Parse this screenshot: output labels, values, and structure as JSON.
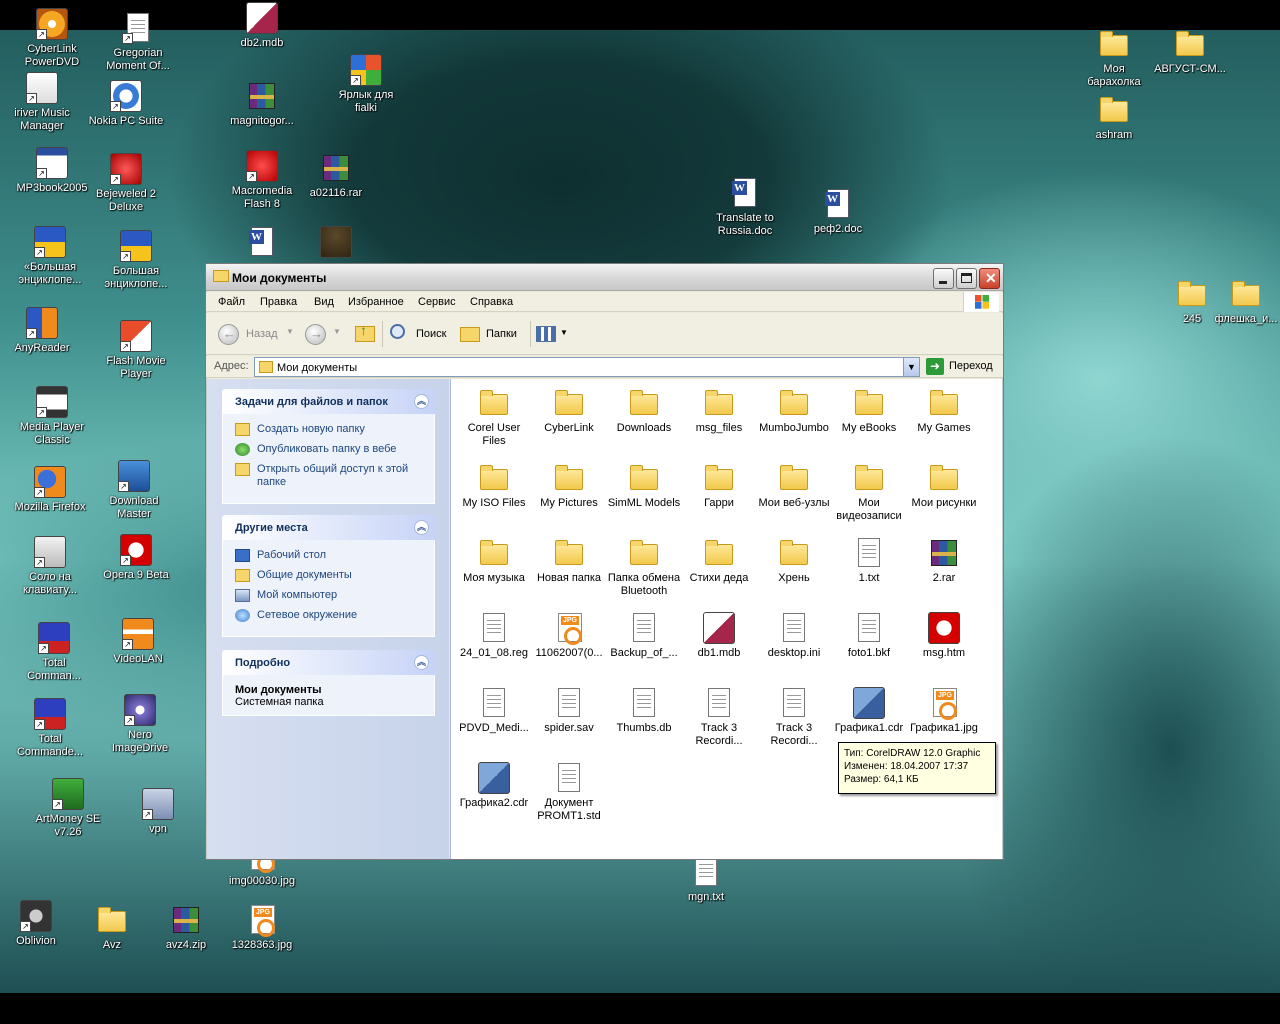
{
  "colors": {
    "wallpaper_dark": "#1e4f53",
    "wallpaper_light": "#8fd6d1",
    "task_link": "#20487e",
    "tooltip_bg": "#ffffe1"
  },
  "desktop_icons": [
    {
      "label": "CyberLink\nPowerDVD",
      "icon": "cyberlink-dvd-icon",
      "shortcut": true
    },
    {
      "label": "Gregorian\nMoment Of...",
      "icon": "text-document-icon",
      "shortcut": true
    },
    {
      "label": "db2.mdb",
      "icon": "access-db-icon",
      "shortcut": false
    },
    {
      "label": "iriver Music\nManager",
      "icon": "iriver-icon",
      "shortcut": true
    },
    {
      "label": "Nokia PC Suite",
      "icon": "nokia-icon",
      "shortcut": true
    },
    {
      "label": "magnitogor...",
      "icon": "rar-archive-icon",
      "shortcut": false
    },
    {
      "label": "Ярлык для\nfialki",
      "icon": "windows-messenger-icon",
      "shortcut": true
    },
    {
      "label": "MP3book2005",
      "icon": "app-window-icon",
      "shortcut": true
    },
    {
      "label": "Bejeweled 2\nDeluxe",
      "icon": "bejeweled-icon",
      "shortcut": true
    },
    {
      "label": "Macromedia\nFlash 8",
      "icon": "flash-icon",
      "shortcut": true
    },
    {
      "label": "a02116.rar",
      "icon": "rar-archive-icon",
      "shortcut": false
    },
    {
      "label": "Translate to\nRussia.doc",
      "icon": "word-document-icon",
      "shortcut": false
    },
    {
      "label": "реф2.doc",
      "icon": "word-document-icon",
      "shortcut": false
    },
    {
      "label": "Моя\nбарахолка",
      "icon": "folder-icon",
      "shortcut": false
    },
    {
      "label": "АВГУСТ-СМ...",
      "icon": "folder-icon",
      "shortcut": false
    },
    {
      "label": "ashram",
      "icon": "folder-icon",
      "shortcut": false
    },
    {
      "label": "«Большая\nэнциклопе...",
      "icon": "encyclopedia-icon",
      "shortcut": true
    },
    {
      "label": "Большая\nэнциклопе...",
      "icon": "encyclopedia-icon",
      "shortcut": true
    },
    {
      "label": "",
      "icon": "word-document-icon",
      "shortcut": false
    },
    {
      "label": "",
      "icon": "tree-icon",
      "shortcut": false
    },
    {
      "label": "245",
      "icon": "folder-icon",
      "shortcut": false
    },
    {
      "label": "флешка_и...",
      "icon": "folder-icon",
      "shortcut": false
    },
    {
      "label": "AnyReader",
      "icon": "anyreader-icon",
      "shortcut": true
    },
    {
      "label": "Flash Movie\nPlayer",
      "icon": "flash-player-icon",
      "shortcut": true
    },
    {
      "label": "Media Player\nClassic",
      "icon": "media-player-icon",
      "shortcut": true
    },
    {
      "label": "Mozilla Firefox",
      "icon": "firefox-icon",
      "shortcut": true
    },
    {
      "label": "Download\nMaster",
      "icon": "download-master-icon",
      "shortcut": true
    },
    {
      "label": "Соло на\nклавиату...",
      "icon": "keyboard-icon",
      "shortcut": true
    },
    {
      "label": "Opera 9 Beta",
      "icon": "opera-icon",
      "shortcut": true
    },
    {
      "label": "Total\nComman...",
      "icon": "total-commander-icon",
      "shortcut": true
    },
    {
      "label": "VideoLAN",
      "icon": "vlc-cone-icon",
      "shortcut": true
    },
    {
      "label": "Total\nCommande...",
      "icon": "total-commander-icon",
      "shortcut": true
    },
    {
      "label": "Nero\nImageDrive",
      "icon": "nero-icon",
      "shortcut": true
    },
    {
      "label": "ArtMoney SE\nv7.26",
      "icon": "artmoney-icon",
      "shortcut": true
    },
    {
      "label": "vpn",
      "icon": "network-connection-icon",
      "shortcut": true
    },
    {
      "label": "img00030.jpg",
      "icon": "jpg-image-icon",
      "shortcut": false
    },
    {
      "label": "mgn.txt",
      "icon": "text-document-icon",
      "shortcut": false
    },
    {
      "label": "Oblivion",
      "icon": "oblivion-icon",
      "shortcut": true
    },
    {
      "label": "Avz",
      "icon": "folder-icon",
      "shortcut": false
    },
    {
      "label": "avz4.zip",
      "icon": "rar-archive-icon",
      "shortcut": false
    },
    {
      "label": "1328363.jpg",
      "icon": "jpg-image-icon",
      "shortcut": false
    }
  ],
  "window": {
    "title": "Мои документы",
    "menu": [
      "Файл",
      "Правка",
      "Вид",
      "Избранное",
      "Сервис",
      "Справка"
    ],
    "toolbar": {
      "back": "Назад",
      "search": "Поиск",
      "folders": "Папки"
    },
    "address_label": "Адрес:",
    "address_value": "Мои документы",
    "go_label": "Переход",
    "task_pane": {
      "file_tasks": {
        "title": "Задачи для файлов и папок",
        "links": [
          "Создать новую папку",
          "Опубликовать папку в вебе",
          "Открыть общий доступ к этой папке"
        ]
      },
      "other_places": {
        "title": "Другие места",
        "links": [
          "Рабочий стол",
          "Общие документы",
          "Мой компьютер",
          "Сетевое окружение"
        ]
      },
      "details": {
        "title": "Подробно",
        "name": "Мои документы",
        "type": "Системная папка"
      }
    },
    "files": [
      {
        "label": "Corel User\nFiles",
        "icon": "folder-icon"
      },
      {
        "label": "CyberLink",
        "icon": "folder-icon"
      },
      {
        "label": "Downloads",
        "icon": "folder-icon"
      },
      {
        "label": "msg_files",
        "icon": "folder-icon"
      },
      {
        "label": "MumboJumbo",
        "icon": "folder-icon"
      },
      {
        "label": "My eBooks",
        "icon": "folder-icon"
      },
      {
        "label": "My Games",
        "icon": "folder-icon"
      },
      {
        "label": "My ISO Files",
        "icon": "folder-icon"
      },
      {
        "label": "My Pictures",
        "icon": "folder-icon"
      },
      {
        "label": "SimML Models",
        "icon": "folder-icon"
      },
      {
        "label": "Гарри",
        "icon": "folder-icon"
      },
      {
        "label": "Мои веб-узлы",
        "icon": "web-folder-icon"
      },
      {
        "label": "Мои\nвидеозаписи",
        "icon": "video-folder-icon"
      },
      {
        "label": "Мои рисунки",
        "icon": "folder-icon"
      },
      {
        "label": "Моя музыка",
        "icon": "music-folder-icon"
      },
      {
        "label": "Новая папка",
        "icon": "folder-icon"
      },
      {
        "label": "Папка обмена\nBluetooth",
        "icon": "folder-icon"
      },
      {
        "label": "Стихи деда",
        "icon": "folder-icon"
      },
      {
        "label": "Хрень",
        "icon": "folder-icon"
      },
      {
        "label": "1.txt",
        "icon": "text-document-icon"
      },
      {
        "label": "2.rar",
        "icon": "rar-archive-icon"
      },
      {
        "label": "24_01_08.reg",
        "icon": "registry-file-icon"
      },
      {
        "label": "11062007(0...",
        "icon": "jpg-image-icon"
      },
      {
        "label": "Backup_of_...",
        "icon": "blank-file-icon"
      },
      {
        "label": "db1.mdb",
        "icon": "access-db-icon"
      },
      {
        "label": "desktop.ini",
        "icon": "settings-file-icon"
      },
      {
        "label": "foto1.bkf",
        "icon": "backup-file-icon"
      },
      {
        "label": "msg.htm",
        "icon": "opera-html-icon"
      },
      {
        "label": "PDVD_Medi...",
        "icon": "generic-file-icon"
      },
      {
        "label": "spider.sav",
        "icon": "generic-file-icon"
      },
      {
        "label": "Thumbs.db",
        "icon": "thumbs-db-icon"
      },
      {
        "label": "Track 3\nRecordi...",
        "icon": "generic-file-icon"
      },
      {
        "label": "Track 3\nRecordi...",
        "icon": "audio-file-icon"
      },
      {
        "label": "Графика1.cdr",
        "icon": "coreldraw-icon"
      },
      {
        "label": "Графика1.jpg",
        "icon": "jpg-image-icon"
      },
      {
        "label": "Графика2.cdr",
        "icon": "coreldraw-icon"
      },
      {
        "label": "Документ\nPROMT1.std",
        "icon": "promt-document-icon"
      }
    ],
    "tooltip": [
      "Тип: CorelDRAW 12.0 Graphic",
      "Изменен: 18.04.2007 17:37",
      "Размер: 64,1 КБ"
    ]
  }
}
